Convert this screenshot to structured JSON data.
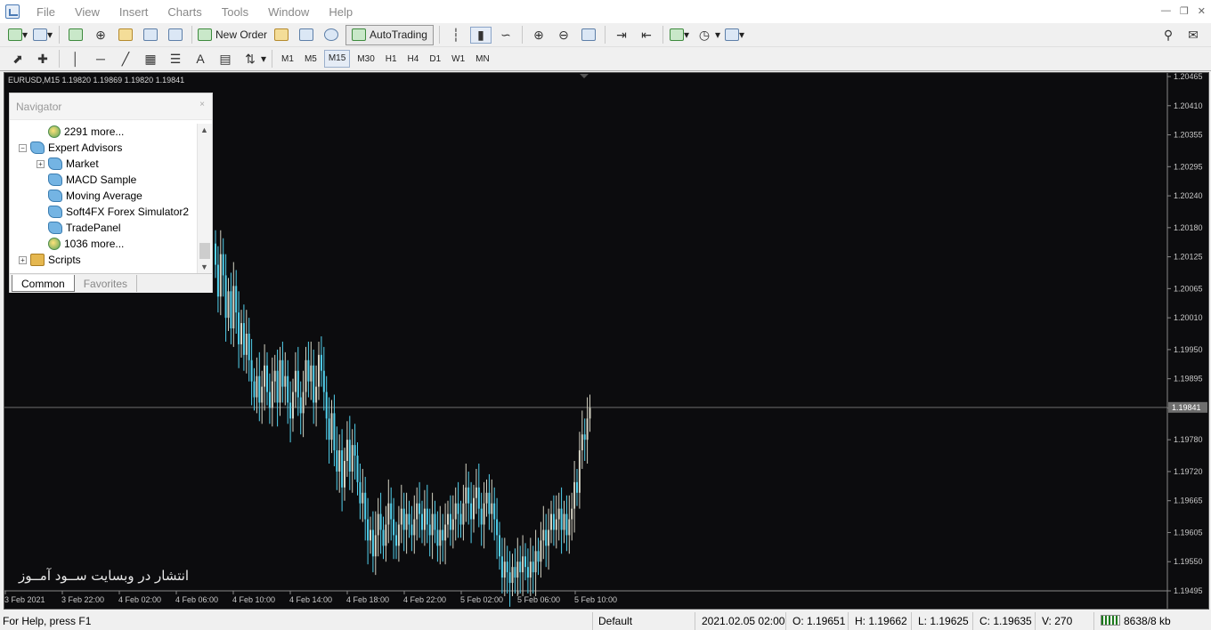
{
  "menu": [
    "File",
    "View",
    "Insert",
    "Charts",
    "Tools",
    "Window",
    "Help"
  ],
  "toolbar": {
    "new_order": "New Order",
    "autotrading": "AutoTrading"
  },
  "timeframes": [
    "M1",
    "M5",
    "M15",
    "M30",
    "H1",
    "H4",
    "D1",
    "W1",
    "MN"
  ],
  "active_timeframe": "M15",
  "chart": {
    "symbol_line": "EURUSD,M15  1.19820 1.19869 1.19820 1.19841",
    "watermark": "انتشار در وبسایت ســود آمــوز",
    "current_price_label": "1.19841",
    "bull_color": "#d4d2c2",
    "bear_color": "#52d1ee"
  },
  "navigator": {
    "title": "Navigator",
    "items": [
      {
        "label": "2291 more...",
        "level": 2,
        "icon": "globe-icon"
      },
      {
        "label": "Expert Advisors",
        "level": 1,
        "icon": "expert-advisor-icon",
        "expanded": true
      },
      {
        "label": "Market",
        "level": 2,
        "icon": "expert-advisor-icon",
        "expandable": true
      },
      {
        "label": "MACD Sample",
        "level": 2,
        "icon": "expert-advisor-icon"
      },
      {
        "label": "Moving Average",
        "level": 2,
        "icon": "expert-advisor-icon"
      },
      {
        "label": "Soft4FX Forex Simulator2",
        "level": 2,
        "icon": "expert-advisor-icon"
      },
      {
        "label": "TradePanel",
        "level": 2,
        "icon": "expert-advisor-icon"
      },
      {
        "label": "1036 more...",
        "level": 2,
        "icon": "globe-icon"
      },
      {
        "label": "Scripts",
        "level": 1,
        "icon": "scripts-icon",
        "expandable": true
      }
    ],
    "tabs": [
      "Common",
      "Favorites"
    ],
    "active_tab": "Common"
  },
  "status": {
    "help": "For Help, press F1",
    "profile": "Default",
    "datetime": "2021.02.05 02:00",
    "open": "O: 1.19651",
    "high": "H: 1.19662",
    "low": "L: 1.19625",
    "close": "C: 1.19635",
    "volume": "V: 270",
    "traffic": "8638/8 kb"
  },
  "chart_data": {
    "type": "candlestick",
    "y_ticks": [
      "1.20465",
      "1.20410",
      "1.20355",
      "1.20295",
      "1.20240",
      "1.20180",
      "1.20125",
      "1.20065",
      "1.20010",
      "1.19950",
      "1.19895",
      "1.19840",
      "1.19780",
      "1.19720",
      "1.19665",
      "1.19605",
      "1.19550",
      "1.19495"
    ],
    "x_ticks": [
      "3 Feb 2021",
      "3 Feb 22:00",
      "4 Feb 02:00",
      "4 Feb 06:00",
      "4 Feb 10:00",
      "4 Feb 14:00",
      "4 Feb 18:00",
      "4 Feb 22:00",
      "5 Feb 02:00",
      "5 Feb 06:00",
      "5 Feb 10:00"
    ],
    "current_price": 1.19841,
    "ylim": [
      1.19495,
      1.20465
    ],
    "closes": [
      1.2011,
      1.2005,
      1.2013,
      1.2009,
      1.2001,
      1.2006,
      1.1999,
      1.2007,
      1.2002,
      1.1996,
      1.2,
      1.1994,
      1.1998,
      1.1993,
      1.1989,
      1.1986,
      1.199,
      1.1985,
      1.1988,
      1.1992,
      1.1987,
      1.1984,
      1.1989,
      1.1991,
      1.1985,
      1.1993,
      1.1988,
      1.199,
      1.1985,
      1.1982,
      1.1987,
      1.1991,
      1.1986,
      1.1983,
      1.1987,
      1.1993,
      1.1989,
      1.1992,
      1.1985,
      1.1988,
      1.1994,
      1.1991,
      1.1987,
      1.1982,
      1.1978,
      1.1983,
      1.1976,
      1.1972,
      1.1976,
      1.1969,
      1.1974,
      1.1978,
      1.1972,
      1.1977,
      1.1975,
      1.197,
      1.1966,
      1.1968,
      1.1963,
      1.1959,
      1.1961,
      1.1956,
      1.196,
      1.1964,
      1.1961,
      1.1958,
      1.1962,
      1.1966,
      1.1963,
      1.196,
      1.1958,
      1.1962,
      1.1965,
      1.1961,
      1.1964,
      1.1962,
      1.196,
      1.1963,
      1.1966,
      1.1964,
      1.1961,
      1.1965,
      1.1962,
      1.196,
      1.1964,
      1.1961,
      1.1958,
      1.1961,
      1.1959,
      1.1962,
      1.1964,
      1.1961,
      1.1963,
      1.1966,
      1.1964,
      1.1962,
      1.1966,
      1.1969,
      1.1966,
      1.1963,
      1.1967,
      1.1969,
      1.1965,
      1.1962,
      1.1966,
      1.1968,
      1.1964,
      1.1966,
      1.1963,
      1.196,
      1.1956,
      1.1952,
      1.1955,
      1.1953,
      1.1951,
      1.1954,
      1.1952,
      1.1955,
      1.1953,
      1.1956,
      1.1954,
      1.1952,
      1.1955,
      1.1953,
      1.1957,
      1.1955,
      1.1959,
      1.1961,
      1.1958,
      1.1961,
      1.1964,
      1.1961,
      1.1963,
      1.1965,
      1.1961,
      1.1964,
      1.196,
      1.1963,
      1.1965,
      1.197,
      1.1968,
      1.1976,
      1.1979,
      1.1978,
      1.1982,
      1.1984
    ]
  }
}
